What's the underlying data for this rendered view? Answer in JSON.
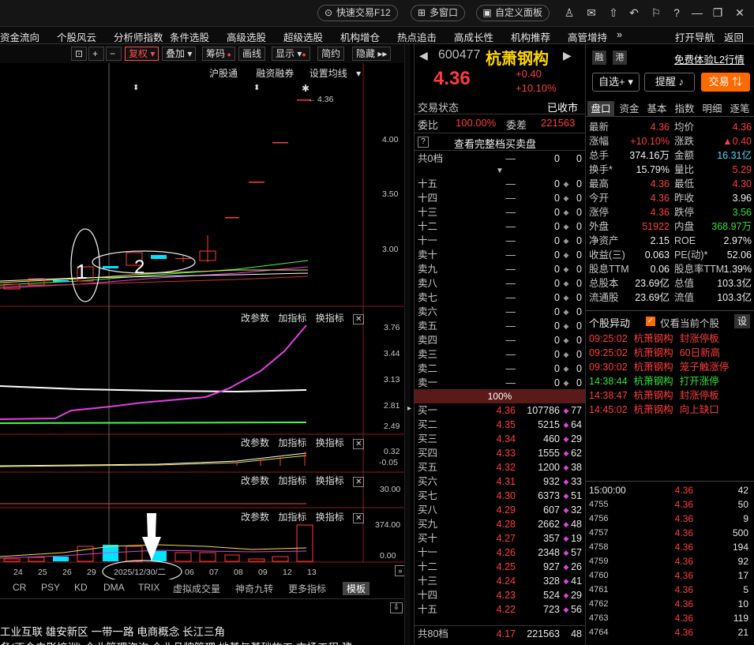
{
  "topbar": {
    "quick_trade": "快速交易F12",
    "multi_window": "多窗口",
    "custom_panel": "自定义面板"
  },
  "menu": [
    "资金流向",
    "个股风云",
    "分析师指数",
    "条件选股",
    "高级选股",
    "超级选股",
    "机构增仓",
    "热点追击",
    "高成长性",
    "机构推荐",
    "高管增持",
    "»",
    "打开导航",
    "返回"
  ],
  "chart_toolbar": {
    "fuquan": "复权",
    "overlay": "叠加",
    "chips": "筹码",
    "draw": "画线",
    "display": "显示",
    "simple": "简约",
    "hide": "隐藏"
  },
  "chart_header_links": [
    "沪股通",
    "融资融券",
    "设置均线"
  ],
  "kline_axis": [
    "4.00",
    "3.50",
    "3.00"
  ],
  "last_price_label": "4.36",
  "annotations": {
    "circle1": "1",
    "circle2": "2"
  },
  "indicator_toolbar": {
    "change_params": "改参数",
    "add_indicator": "加指标",
    "switch_indicator": "换指标"
  },
  "ind1_axis": [
    "3.76",
    "3.44",
    "3.13",
    "2.81",
    "2.49"
  ],
  "ind2_axis": [
    "0.32",
    "-0.05"
  ],
  "ind3_axis": [
    "30.00"
  ],
  "ind4_axis": [
    "374.00",
    "0.00"
  ],
  "date_axis": [
    "24",
    "25",
    "26",
    "29",
    "2025/12/30/二",
    "06",
    "07",
    "08",
    "09",
    "12",
    "13"
  ],
  "bottom_tabs": [
    "CR",
    "PSY",
    "KD",
    "DMA",
    "TRIX",
    "虚拟成交量",
    "神奇九转",
    "更多指标",
    "模板"
  ],
  "concepts_line1": "工业互联  雄安新区  一带一路  电商概念  长江三角",
  "concepts_line2": "务(不含电影培训)  企业管理咨询  企业品牌管理  地基与基础施工  市场工程  建",
  "stock": {
    "code": "600477",
    "name": "杭萧钢构",
    "badge1": "融",
    "badge2": "港",
    "l2": "免费体验L2行情",
    "price": "4.36",
    "change": "+0.40",
    "change_pct": "+10.10%",
    "watchlist": "自选+",
    "alert": "提醒",
    "trade": "交易"
  },
  "trade_status": {
    "label": "交易状态",
    "value": "已收市"
  },
  "weibi": {
    "label": "委比",
    "value": "100.00%",
    "label2": "委差",
    "value2": "221563"
  },
  "full_book": "查看完整档买卖盘",
  "sell_total": {
    "label": "共0档",
    "price": "—",
    "vol": "0",
    "cnt": "0"
  },
  "sell_levels": [
    {
      "label": "十五",
      "price": "—",
      "vol": "0",
      "cnt": "0"
    },
    {
      "label": "十四",
      "price": "—",
      "vol": "0",
      "cnt": "0"
    },
    {
      "label": "十三",
      "price": "—",
      "vol": "0",
      "cnt": "0"
    },
    {
      "label": "十二",
      "price": "—",
      "vol": "0",
      "cnt": "0"
    },
    {
      "label": "十一",
      "price": "—",
      "vol": "0",
      "cnt": "0"
    },
    {
      "label": "卖十",
      "price": "—",
      "vol": "0",
      "cnt": "0"
    },
    {
      "label": "卖九",
      "price": "—",
      "vol": "0",
      "cnt": "0"
    },
    {
      "label": "卖八",
      "price": "—",
      "vol": "0",
      "cnt": "0"
    },
    {
      "label": "卖七",
      "price": "—",
      "vol": "0",
      "cnt": "0"
    },
    {
      "label": "卖六",
      "price": "—",
      "vol": "0",
      "cnt": "0"
    },
    {
      "label": "卖五",
      "price": "—",
      "vol": "0",
      "cnt": "0"
    },
    {
      "label": "卖四",
      "price": "—",
      "vol": "0",
      "cnt": "0"
    },
    {
      "label": "卖三",
      "price": "—",
      "vol": "0",
      "cnt": "0"
    },
    {
      "label": "卖二",
      "price": "—",
      "vol": "0",
      "cnt": "0"
    },
    {
      "label": "卖一",
      "price": "—",
      "vol": "0",
      "cnt": "0"
    }
  ],
  "mid_pct": "100%",
  "buy_levels": [
    {
      "label": "买一",
      "price": "4.36",
      "vol": "107786",
      "cnt": "77"
    },
    {
      "label": "买二",
      "price": "4.35",
      "vol": "5215",
      "cnt": "64"
    },
    {
      "label": "买三",
      "price": "4.34",
      "vol": "460",
      "cnt": "29"
    },
    {
      "label": "买四",
      "price": "4.33",
      "vol": "1555",
      "cnt": "62"
    },
    {
      "label": "买五",
      "price": "4.32",
      "vol": "1200",
      "cnt": "38"
    },
    {
      "label": "买六",
      "price": "4.31",
      "vol": "932",
      "cnt": "33"
    },
    {
      "label": "买七",
      "price": "4.30",
      "vol": "6373",
      "cnt": "51"
    },
    {
      "label": "买八",
      "price": "4.29",
      "vol": "607",
      "cnt": "32"
    },
    {
      "label": "买九",
      "price": "4.28",
      "vol": "2662",
      "cnt": "48"
    },
    {
      "label": "买十",
      "price": "4.27",
      "vol": "357",
      "cnt": "19"
    },
    {
      "label": "十一",
      "price": "4.26",
      "vol": "2348",
      "cnt": "57"
    },
    {
      "label": "十二",
      "price": "4.25",
      "vol": "927",
      "cnt": "26"
    },
    {
      "label": "十三",
      "price": "4.24",
      "vol": "328",
      "cnt": "41"
    },
    {
      "label": "十四",
      "price": "4.23",
      "vol": "524",
      "cnt": "29"
    },
    {
      "label": "十五",
      "price": "4.22",
      "vol": "723",
      "cnt": "56"
    }
  ],
  "buy_total": {
    "label": "共80档",
    "price": "4.17",
    "vol": "221563",
    "cnt": "48"
  },
  "side_tabs": [
    "盘口",
    "资金",
    "基本",
    "指数",
    "明细",
    "逐笔"
  ],
  "quote": [
    {
      "k1": "最新",
      "v1": "4.36",
      "k2": "均价",
      "v2": "4.36"
    },
    {
      "k1": "涨幅",
      "v1": "+10.10%",
      "k2": "涨跌",
      "v2": "▲0.40"
    },
    {
      "k1": "总手",
      "v1": "374.16万",
      "k2": "金额",
      "v2": "16.31亿"
    },
    {
      "k1": "换手*",
      "v1": "15.79%",
      "k2": "量比",
      "v2": "5.29"
    },
    {
      "k1": "最高",
      "v1": "4.36",
      "k2": "最低",
      "v2": "4.30"
    },
    {
      "k1": "今开",
      "v1": "4.36",
      "k2": "昨收",
      "v2": "3.96"
    },
    {
      "k1": "涨停",
      "v1": "4.36",
      "k2": "跌停",
      "v2": "3.56"
    },
    {
      "k1": "外盘",
      "v1": "51922",
      "k2": "内盘",
      "v2": "368.97万"
    },
    {
      "k1": "净资产",
      "v1": "2.15",
      "k2": "ROE",
      "v2": "2.97%"
    },
    {
      "k1": "收益(三)",
      "v1": "0.063",
      "k2": "PE(动)*",
      "v2": "52.06"
    },
    {
      "k1": "股息TTM",
      "v1": "0.06",
      "k2": "股息率TTM",
      "v2": "1.39%"
    },
    {
      "k1": "总股本",
      "v1": "23.69亿",
      "k2": "总值",
      "v2": "103.3亿"
    },
    {
      "k1": "流通股",
      "v1": "23.69亿",
      "k2": "流值",
      "v2": "103.3亿"
    }
  ],
  "events_header": {
    "title": "个股异动",
    "checkbox_label": "仅看当前个股",
    "settings": "设"
  },
  "events": [
    {
      "time": "09:25:02",
      "name": "杭萧钢构",
      "desc": "封涨停板",
      "color": "red"
    },
    {
      "time": "09:25:02",
      "name": "杭萧钢构",
      "desc": "60日新高",
      "color": "red"
    },
    {
      "time": "09:30:02",
      "name": "杭萧钢构",
      "desc": "笼子触涨停",
      "color": "red"
    },
    {
      "time": "14:38:44",
      "name": "杭萧钢构",
      "desc": "打开涨停",
      "color": "green"
    },
    {
      "time": "14:38:47",
      "name": "杭萧钢构",
      "desc": "封涨停板",
      "color": "red"
    },
    {
      "time": "14:45:02",
      "name": "杭萧钢构",
      "desc": "向上缺口",
      "color": "red"
    }
  ],
  "ticks": [
    {
      "t": "15:00:00",
      "p": "4.36",
      "v": "42"
    },
    {
      "t": "4755",
      "p": "4.36",
      "v": "50"
    },
    {
      "t": "4756",
      "p": "4.36",
      "v": "9"
    },
    {
      "t": "4757",
      "p": "4.36",
      "v": "500"
    },
    {
      "t": "4758",
      "p": "4.36",
      "v": "194"
    },
    {
      "t": "4759",
      "p": "4.36",
      "v": "92"
    },
    {
      "t": "4760",
      "p": "4.36",
      "v": "17"
    },
    {
      "t": "4761",
      "p": "4.36",
      "v": "5"
    },
    {
      "t": "4762",
      "p": "4.36",
      "v": "10"
    },
    {
      "t": "4763",
      "p": "4.36",
      "v": "119"
    },
    {
      "t": "4764",
      "p": "4.36",
      "v": "21"
    }
  ],
  "colors": {
    "up": "#ff3c3c",
    "down": "#33e033",
    "accent": "#ff6a00",
    "ma_white": "#ffffff",
    "ma_yellow": "#f0e040",
    "ma_magenta": "#e040e0",
    "ma_green": "#40ff40",
    "volume_cyan": "#00e5ff"
  }
}
